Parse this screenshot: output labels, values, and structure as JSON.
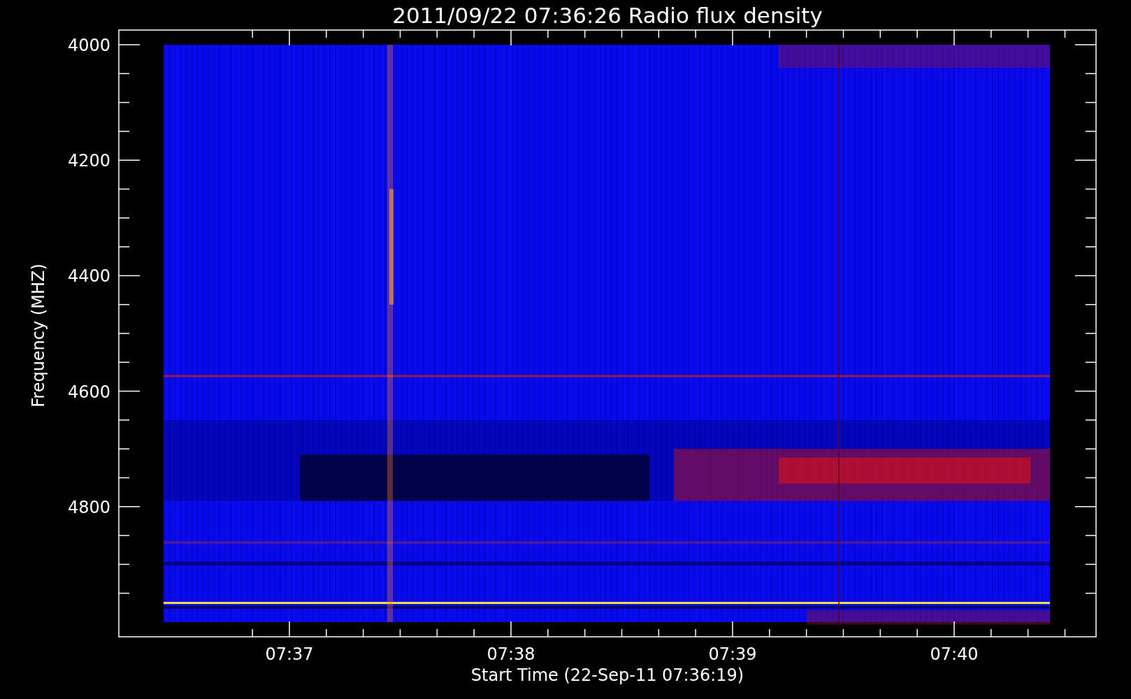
{
  "title": "2011/09/22 07:36:26 Radio flux density",
  "y_axis": {
    "label": "Frequency (MHZ)",
    "ticks": [
      "4000",
      "4200",
      "4400",
      "4600",
      "4800"
    ]
  },
  "x_axis": {
    "label": "Start Time (22-Sep-11 07:36:19)",
    "ticks": [
      "07:37",
      "07:38",
      "07:39",
      "07:40"
    ]
  }
}
